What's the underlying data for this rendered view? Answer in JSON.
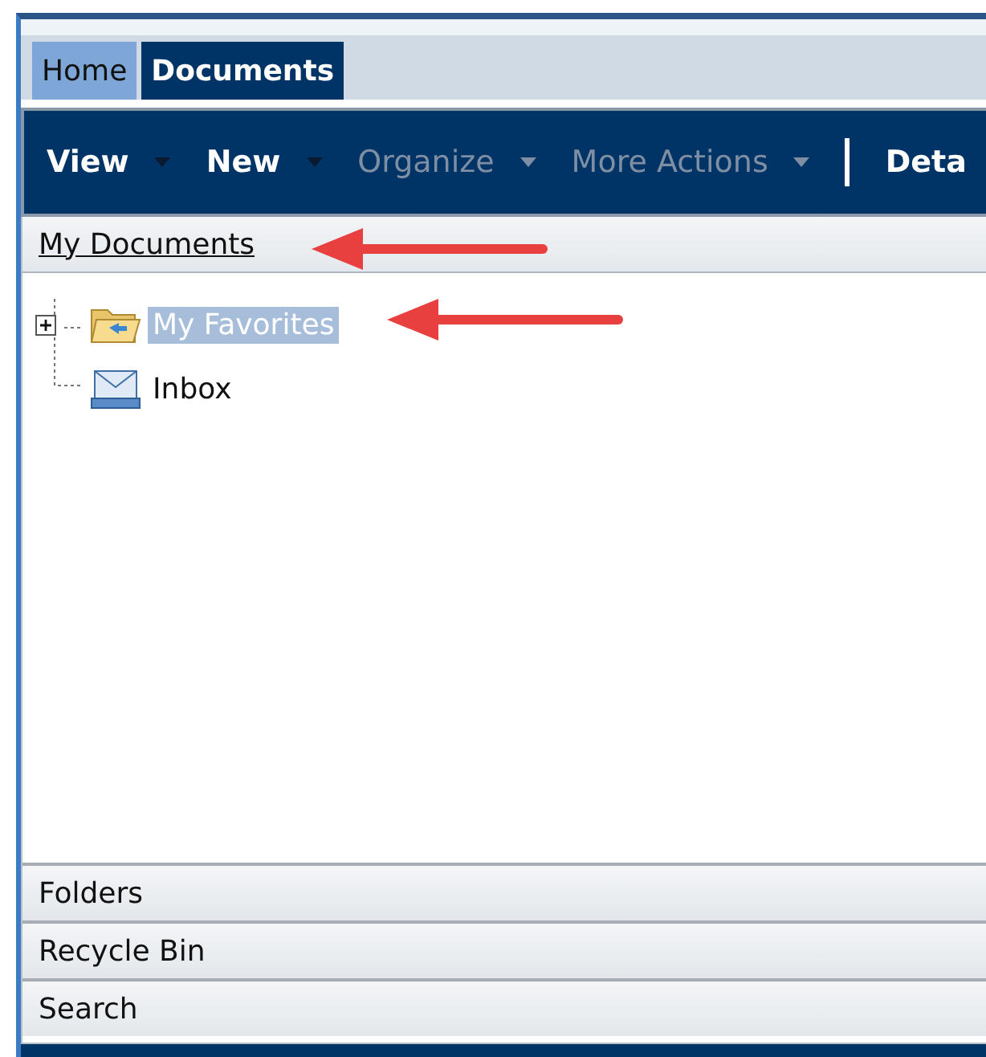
{
  "tabs": [
    {
      "label": "Home",
      "selected": false
    },
    {
      "label": "Documents",
      "selected": true
    }
  ],
  "toolbar": [
    {
      "kind": "menu",
      "label": "View",
      "disabled": false
    },
    {
      "kind": "menu",
      "label": "New",
      "disabled": false
    },
    {
      "kind": "menu",
      "label": "Organize",
      "disabled": true
    },
    {
      "kind": "menu",
      "label": "More Actions",
      "disabled": true
    },
    {
      "kind": "separator"
    },
    {
      "kind": "button",
      "label": "Deta",
      "disabled": false
    }
  ],
  "panel": {
    "title": "My Documents"
  },
  "tree": [
    {
      "kind": "folder",
      "label": "My Favorites",
      "selected": true,
      "expanded": false
    },
    {
      "kind": "inbox",
      "label": "Inbox",
      "selected": false
    }
  ],
  "sections": [
    {
      "label": "Folders"
    },
    {
      "label": "Recycle Bin"
    },
    {
      "label": "Search"
    }
  ]
}
